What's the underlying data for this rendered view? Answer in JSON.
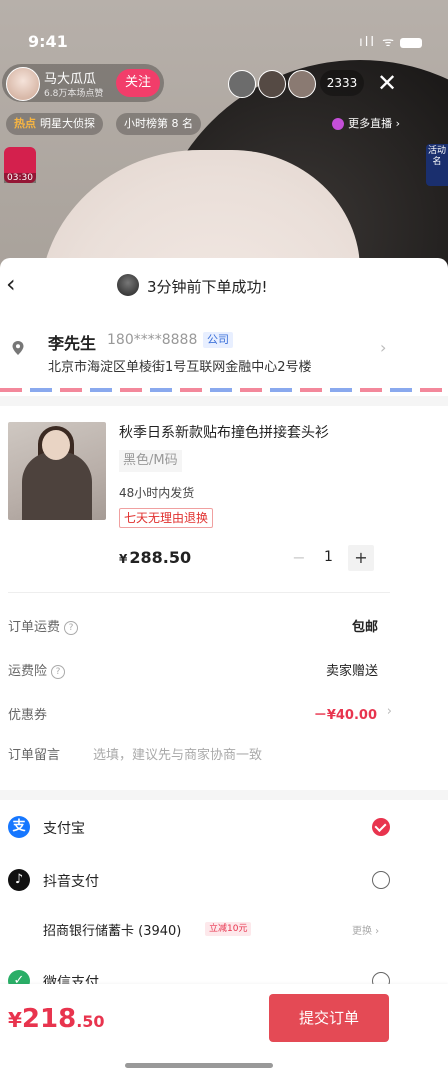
{
  "status_bar": {
    "time": "9:41",
    "signal": "ıll ᯤ"
  },
  "live": {
    "host_name": "马大瓜瓜",
    "host_likes": "6.8万本场点赞",
    "follow_label": "关注",
    "viewer_count": "2333",
    "close_label": "✕",
    "hot_tag": "热点",
    "hot_title": "明星大侦探",
    "rank_label": "小时榜第 8 名",
    "more_live_label": "更多直播 ›",
    "activity_label": "活动名",
    "gift_timer": "03:30"
  },
  "sheet": {
    "back_label": "‹",
    "order_message": "3分钟前下单成功!"
  },
  "address": {
    "name": "李先生",
    "phone": "180****8888",
    "tag": "公司",
    "line": "北京市海淀区单棱街1号互联网金融中心2号楼",
    "chevron": "›"
  },
  "product": {
    "title": "秋季日系新款贴布撞色拼接套头衫",
    "spec": "黑色/M码",
    "ship_time": "48小时内发货",
    "return_policy": "七天无理由退换",
    "price_symbol": "¥",
    "price": "288.50",
    "quantity": "1",
    "minus": "−",
    "plus": "+"
  },
  "fees": {
    "shipping_label": "订单运费",
    "shipping_value": "包邮",
    "insurance_label": "运费险",
    "insurance_value": "卖家赠送",
    "coupon_label": "优惠券",
    "coupon_value": "－¥40.00",
    "remark_label": "订单留言",
    "remark_placeholder": "选填，建议先与商家协商一致",
    "help": "?",
    "chevron": "›"
  },
  "payment": {
    "alipay_label": "支付宝",
    "alipay_icon": "支",
    "douyin_label": "抖音支付",
    "douyin_icon": "♪",
    "bank_label": "招商银行储蓄卡 (3940)",
    "bank_promo": "立减10元",
    "bank_change": "更换 ›",
    "wechat_label": "微信支付",
    "wechat_icon": "✓",
    "selected": "alipay"
  },
  "bottom": {
    "total_symbol": "¥",
    "total_int": "218",
    "total_dec": ".50",
    "submit_label": "提交订单"
  },
  "colors": {
    "accent": "#e8344e",
    "submit": "#e44a55",
    "alipay": "#1677ff",
    "wechat": "#2aae67"
  }
}
